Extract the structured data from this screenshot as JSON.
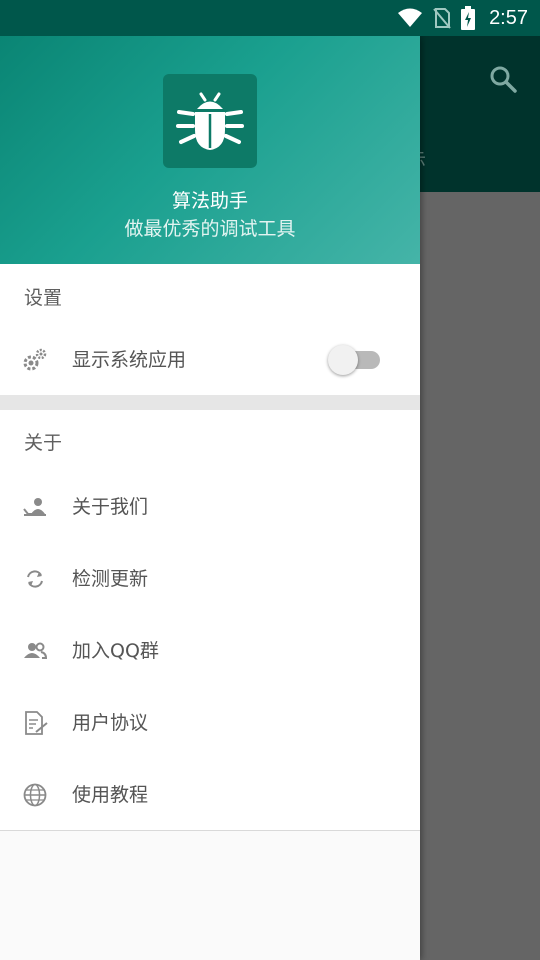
{
  "status_bar": {
    "time": "2:57",
    "icons": [
      "wifi-icon",
      "no-sim-icon",
      "battery-charging-icon"
    ]
  },
  "background_app": {
    "toolbar_color": "#00332c",
    "search_icon": "search-icon",
    "tab_fragment": "示"
  },
  "drawer": {
    "header": {
      "logo_icon": "bug-icon",
      "app_name": "算法助手",
      "slogan": "做最优秀的调试工具"
    },
    "sections": [
      {
        "title": "设置",
        "items": [
          {
            "label": "显示系统应用",
            "icon": "gears-icon",
            "toggle": false
          }
        ]
      },
      {
        "title": "关于",
        "items": [
          {
            "label": "关于我们",
            "icon": "about-us-icon"
          },
          {
            "label": "检测更新",
            "icon": "refresh-icon"
          },
          {
            "label": "加入QQ群",
            "icon": "group-icon"
          },
          {
            "label": "用户协议",
            "icon": "document-edit-icon"
          },
          {
            "label": "使用教程",
            "icon": "globe-icon"
          }
        ]
      }
    ]
  },
  "colors": {
    "header_start": "#0a8574",
    "header_end": "#45b4a8",
    "status_bar": "#00574b"
  }
}
